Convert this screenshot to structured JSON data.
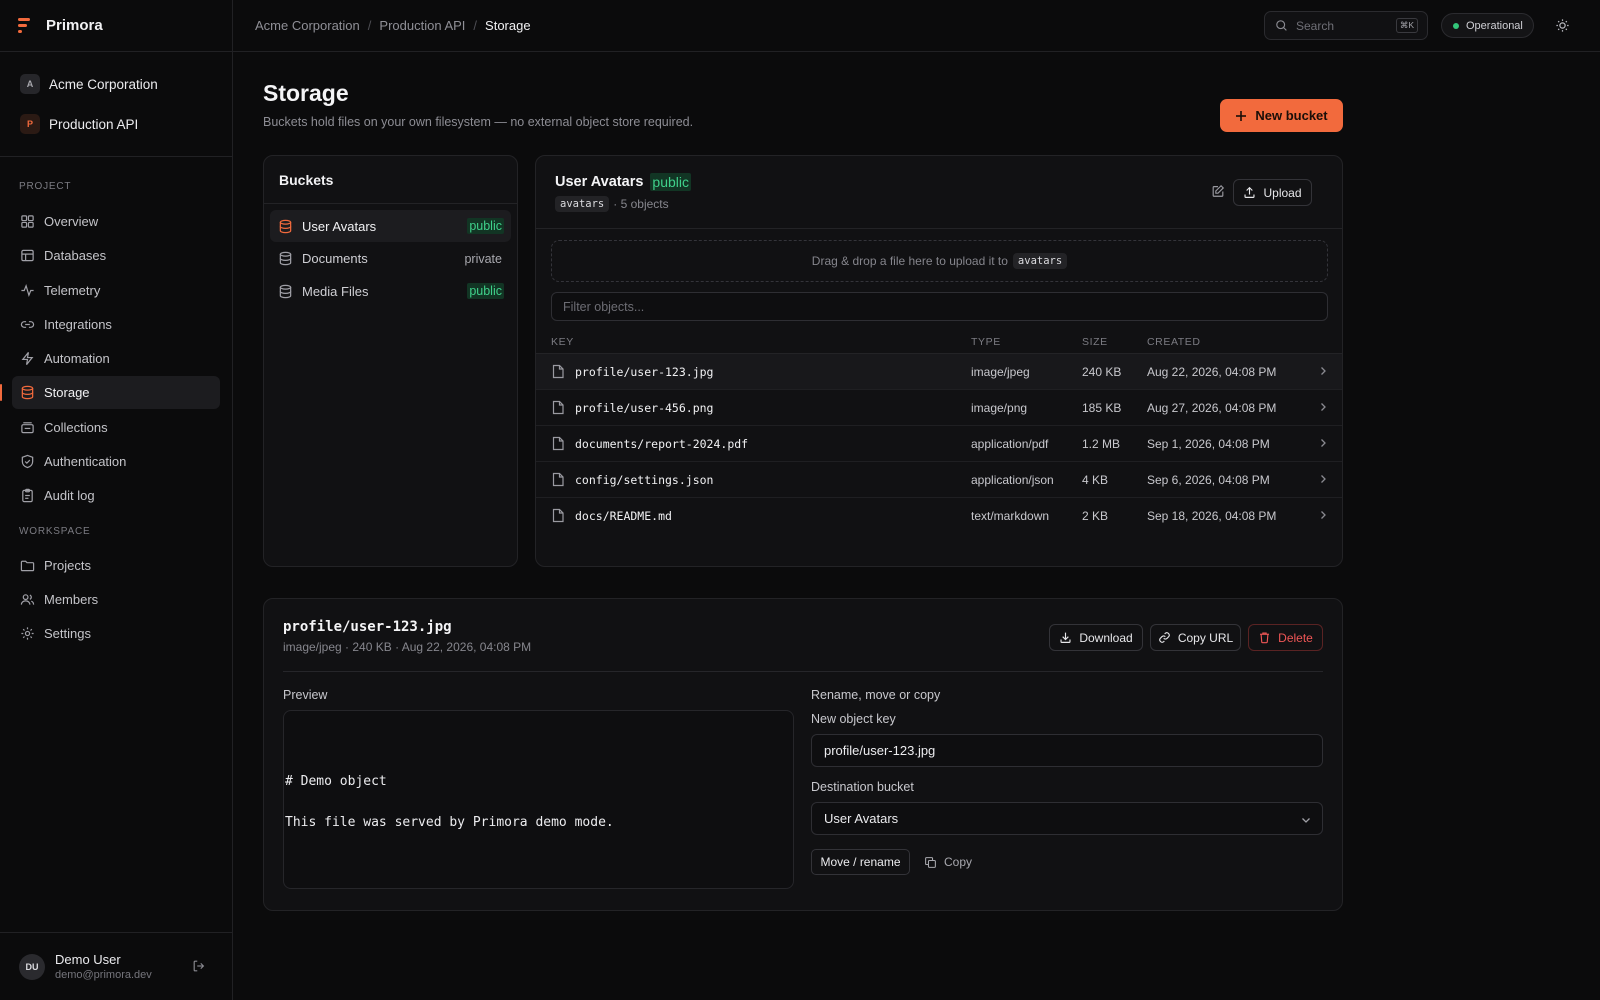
{
  "app": {
    "name": "Primora"
  },
  "context": {
    "org": {
      "initial": "A",
      "name": "Acme Corporation"
    },
    "project": {
      "initial": "P",
      "name": "Production API"
    }
  },
  "sidebar": {
    "project_label": "PROJECT",
    "workspace_label": "WORKSPACE",
    "project_items": [
      {
        "label": "Overview",
        "icon": "overview-icon"
      },
      {
        "label": "Databases",
        "icon": "database-icon"
      },
      {
        "label": "Telemetry",
        "icon": "activity-icon"
      },
      {
        "label": "Integrations",
        "icon": "link-icon"
      },
      {
        "label": "Automation",
        "icon": "bolt-icon"
      },
      {
        "label": "Storage",
        "icon": "storage-icon",
        "active": true
      },
      {
        "label": "Collections",
        "icon": "collections-icon"
      },
      {
        "label": "Authentication",
        "icon": "shield-icon"
      },
      {
        "label": "Audit log",
        "icon": "clipboard-icon"
      }
    ],
    "workspace_items": [
      {
        "label": "Projects",
        "icon": "folder-icon"
      },
      {
        "label": "Members",
        "icon": "users-icon"
      },
      {
        "label": "Settings",
        "icon": "gear-icon"
      }
    ]
  },
  "user": {
    "initials": "DU",
    "name": "Demo User",
    "email": "demo@primora.dev"
  },
  "topbar": {
    "breadcrumbs": [
      "Acme Corporation",
      "Production API",
      "Storage"
    ],
    "search_placeholder": "Search",
    "search_shortcut": "⌘K",
    "status": "Operational"
  },
  "page": {
    "title": "Storage",
    "subtitle": "Buckets hold files on your own filesystem — no external object store required.",
    "new_bucket_label": "New bucket"
  },
  "buckets": {
    "title": "Buckets",
    "items": [
      {
        "name": "User Avatars",
        "visibility": "public",
        "active": true
      },
      {
        "name": "Documents",
        "visibility": "private"
      },
      {
        "name": "Media Files",
        "visibility": "public"
      }
    ]
  },
  "objects": {
    "bucket_name": "User Avatars",
    "visibility": "public",
    "slug": "avatars",
    "count_text": "· 5 objects",
    "upload_label": "Upload",
    "dropzone_text": "Drag & drop a file here to upload it to",
    "filter_placeholder": "Filter objects...",
    "columns": {
      "key": "KEY",
      "type": "TYPE",
      "size": "SIZE",
      "created": "CREATED"
    },
    "rows": [
      {
        "key": "profile/user-123.jpg",
        "type": "image/jpeg",
        "size": "240 KB",
        "created": "Aug 22, 2026, 04:08 PM",
        "selected": true
      },
      {
        "key": "profile/user-456.png",
        "type": "image/png",
        "size": "185 KB",
        "created": "Aug 27, 2026, 04:08 PM"
      },
      {
        "key": "documents/report-2024.pdf",
        "type": "application/pdf",
        "size": "1.2 MB",
        "created": "Sep 1, 2026, 04:08 PM"
      },
      {
        "key": "config/settings.json",
        "type": "application/json",
        "size": "4 KB",
        "created": "Sep 6, 2026, 04:08 PM"
      },
      {
        "key": "docs/README.md",
        "type": "text/markdown",
        "size": "2 KB",
        "created": "Sep 18, 2026, 04:08 PM"
      }
    ]
  },
  "detail": {
    "key": "profile/user-123.jpg",
    "meta": "image/jpeg · 240 KB · Aug 22, 2026, 04:08 PM",
    "download_label": "Download",
    "copy_url_label": "Copy URL",
    "delete_label": "Delete",
    "preview_label": "Preview",
    "preview_content": "# Demo object\n\nThis file was served by Primora demo mode.",
    "rename_section_label": "Rename, move or copy",
    "new_key_label": "New object key",
    "new_key_value": "profile/user-123.jpg",
    "destination_label": "Destination bucket",
    "destination_value": "User Avatars",
    "move_label": "Move / rename",
    "copy_label": "Copy"
  },
  "colors": {
    "accent": "#f26a3d",
    "success": "#3fd08a",
    "danger": "#ef5656",
    "background": "#0b0b0c"
  }
}
